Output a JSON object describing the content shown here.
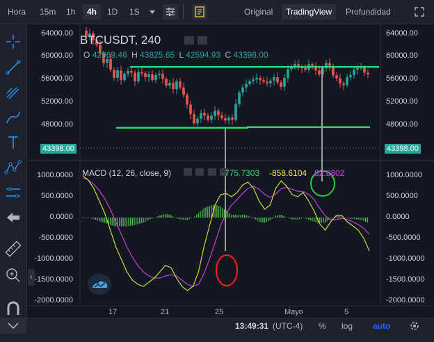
{
  "toolbar": {
    "intervals": [
      {
        "label": "Hora",
        "active": false
      },
      {
        "label": "15m",
        "active": false
      },
      {
        "label": "1h",
        "active": false
      },
      {
        "label": "4h",
        "active": true
      },
      {
        "label": "1D",
        "active": false
      },
      {
        "label": "1S",
        "active": false
      }
    ],
    "view_tabs": [
      {
        "label": "Original",
        "selected": false
      },
      {
        "label": "TradingView",
        "selected": true
      },
      {
        "label": "Profundidad",
        "selected": false
      }
    ]
  },
  "sidebar": {
    "tools": [
      "crosshair-icon",
      "trendline-icon",
      "fib-icon",
      "brush-icon",
      "text-icon",
      "pattern-icon",
      "measure-icon",
      "back-arrow-icon",
      "ruler-icon",
      "zoom-icon",
      "magnet-icon"
    ]
  },
  "legend": {
    "symbol": "BTCUSDT, 240",
    "open_label": "O",
    "open": "42969.46",
    "high_label": "H",
    "high": "43825.65",
    "low_label": "L",
    "low": "42594.93",
    "close_label": "C",
    "close": "43398.00"
  },
  "macd_legend": {
    "name": "MACD (12, 26, close, 9)",
    "v1": "-775.7303",
    "v2": "-858.6104",
    "v3": "82.8802"
  },
  "price_axis": {
    "ticks": [
      "64000.00",
      "60000.00",
      "56000.00",
      "52000.00",
      "48000.00"
    ],
    "current": "43398.00"
  },
  "macd_axis": {
    "ticks": [
      "1000.0000",
      "500.0000",
      "0.0000",
      "-500.0000",
      "-1000.0000",
      "-1500.0000",
      "-2000.0000"
    ]
  },
  "time_axis": {
    "ticks": [
      "17",
      "21",
      "25",
      "Mayo",
      "5"
    ]
  },
  "bottom": {
    "time": "13:49:31",
    "tz": "(UTC-4)",
    "percent": "%",
    "log": "log",
    "auto": "auto"
  },
  "colors": {
    "up": "#26a69a",
    "down": "#ef5350",
    "macd_line": "#cddc39",
    "signal_line": "#c53fd6",
    "hist": "#4caf50",
    "annotation_line": "#36d36a",
    "circle_red": "#ff1f1f",
    "circle_green": "#2ecc40",
    "accent": "#2962ff"
  },
  "chart_data": [
    {
      "type": "candlestick",
      "title": "BTCUSDT, 240",
      "x_ticks": [
        "17",
        "21",
        "25",
        "Mayo",
        "5"
      ],
      "ylim": [
        44000,
        66000
      ],
      "ohlc_last": {
        "open": 42969.46,
        "high": 43825.65,
        "low": 42594.93,
        "close": 43398.0
      },
      "closes": [
        64500,
        63500,
        64000,
        62800,
        62000,
        60500,
        58800,
        59500,
        57600,
        56200,
        57500,
        55800,
        56900,
        57400,
        57100,
        55600,
        57200,
        57000,
        56300,
        56800,
        55800,
        56700,
        56900,
        56000,
        54800,
        55300,
        54200,
        55600,
        54500,
        53200,
        51500,
        49800,
        48200,
        49000,
        50000,
        49600,
        48800,
        49500,
        50400,
        49600,
        49100,
        48700,
        49200,
        48800,
        51600,
        53600,
        54500,
        55100,
        55600,
        55900,
        56200,
        55800,
        55500,
        55200,
        55700,
        56300,
        55400,
        54600,
        56200,
        57700,
        58200,
        58600,
        58200,
        57900,
        57600,
        58600,
        58300,
        57500,
        56800,
        57900,
        58800,
        58300,
        56600,
        56100,
        55200,
        54900,
        56300,
        56700,
        57600,
        57900,
        58000,
        57100,
        56800
      ],
      "support_line": 47400,
      "resistance_line": 59200
    },
    {
      "type": "line",
      "title": "MACD (12, 26, close, 9)",
      "ylim": [
        -2000,
        1000
      ],
      "series": [
        {
          "name": "MACD",
          "values": [
            1000,
            900,
            700,
            400,
            100,
            -300,
            -700,
            -1000,
            -1300,
            -1500,
            -1600,
            -1650,
            -1550,
            -1450,
            -1300,
            -1150,
            -1200,
            -1450,
            -1650,
            -1750,
            -1650,
            -1300,
            -700,
            -200,
            300,
            550,
            580,
            500,
            600,
            780,
            850,
            700,
            400,
            200,
            300,
            700,
            880,
            750,
            550,
            500,
            600,
            400,
            150,
            -150,
            -300,
            -100,
            50,
            50,
            -100,
            -200,
            -300,
            -500,
            -800
          ]
        },
        {
          "name": "Signal",
          "values": [
            950,
            900,
            800,
            650,
            450,
            200,
            -100,
            -400,
            -700,
            -950,
            -1150,
            -1300,
            -1400,
            -1450,
            -1450,
            -1400,
            -1370,
            -1400,
            -1500,
            -1600,
            -1650,
            -1600,
            -1350,
            -1000,
            -600,
            -200,
            100,
            300,
            430,
            580,
            700,
            750,
            680,
            560,
            480,
            560,
            690,
            720,
            680,
            630,
            620,
            560,
            430,
            220,
            40,
            -50,
            -50,
            -20,
            -50,
            -100,
            -170,
            -260,
            -400
          ]
        }
      ]
    }
  ]
}
